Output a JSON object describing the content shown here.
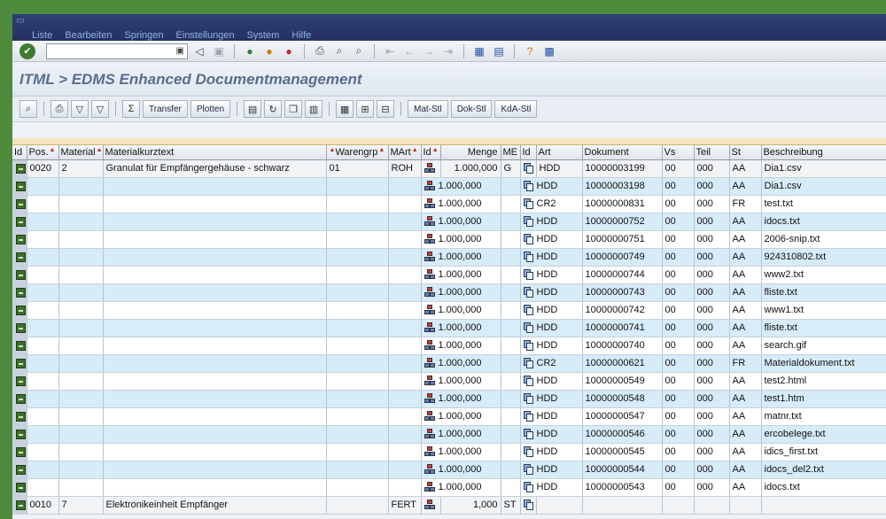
{
  "menu": [
    "Liste",
    "Bearbeiten",
    "Springen",
    "Einstellungen",
    "System",
    "Hilfe"
  ],
  "title": "ITML > EDMS Enhanced Documentmanagement",
  "toolbar_buttons": {
    "transfer": "Transfer",
    "plotten": "Plotten",
    "matstl": "Mat-Stl",
    "dokstl": "Dok-Stl",
    "kdastl": "KdA-Stl"
  },
  "columns": [
    "Id",
    "Pos.",
    "Material",
    "Materialkurztext",
    "Warengrp",
    "MArt",
    "Id",
    "Menge",
    "ME",
    "Id",
    "Art",
    "Dokument",
    "Vs",
    "Teil",
    "St",
    "Beschreibung"
  ],
  "main_rows": [
    {
      "pos": "0020",
      "material": "2",
      "text": "Granulat für Empfängergehäuse - schwarz",
      "warengrp": "01",
      "mart": "ROH",
      "menge": "1.000,000",
      "me": "G",
      "art": "HDD",
      "dokument": "10000003199",
      "vs": "00",
      "teil": "000",
      "st": "AA",
      "beschreibung": "Dia1.csv"
    },
    {
      "pos": "0010",
      "material": "7",
      "text": "Elektronikeinheit Empfänger",
      "warengrp": "",
      "mart": "FERT",
      "menge": "1,000",
      "me": "ST",
      "art": "",
      "dokument": "",
      "vs": "",
      "teil": "",
      "st": "",
      "beschreibung": ""
    }
  ],
  "doc_rows": [
    {
      "menge": "1.000,000",
      "art": "HDD",
      "dokument": "10000003198",
      "vs": "00",
      "teil": "000",
      "st": "AA",
      "beschreibung": "Dia1.csv"
    },
    {
      "menge": "1.000,000",
      "art": "CR2",
      "dokument": "10000000831",
      "vs": "00",
      "teil": "000",
      "st": "FR",
      "beschreibung": "test.txt"
    },
    {
      "menge": "1.000,000",
      "art": "HDD",
      "dokument": "10000000752",
      "vs": "00",
      "teil": "000",
      "st": "AA",
      "beschreibung": "idocs.txt"
    },
    {
      "menge": "1.000,000",
      "art": "HDD",
      "dokument": "10000000751",
      "vs": "00",
      "teil": "000",
      "st": "AA",
      "beschreibung": "2006-snip.txt"
    },
    {
      "menge": "1.000,000",
      "art": "HDD",
      "dokument": "10000000749",
      "vs": "00",
      "teil": "000",
      "st": "AA",
      "beschreibung": "924310802.txt"
    },
    {
      "menge": "1.000,000",
      "art": "HDD",
      "dokument": "10000000744",
      "vs": "00",
      "teil": "000",
      "st": "AA",
      "beschreibung": "www2.txt"
    },
    {
      "menge": "1.000,000",
      "art": "HDD",
      "dokument": "10000000743",
      "vs": "00",
      "teil": "000",
      "st": "AA",
      "beschreibung": "fliste.txt"
    },
    {
      "menge": "1.000,000",
      "art": "HDD",
      "dokument": "10000000742",
      "vs": "00",
      "teil": "000",
      "st": "AA",
      "beschreibung": "www1.txt"
    },
    {
      "menge": "1.000,000",
      "art": "HDD",
      "dokument": "10000000741",
      "vs": "00",
      "teil": "000",
      "st": "AA",
      "beschreibung": "fliste.txt"
    },
    {
      "menge": "1.000,000",
      "art": "HDD",
      "dokument": "10000000740",
      "vs": "00",
      "teil": "000",
      "st": "AA",
      "beschreibung": "search.gif"
    },
    {
      "menge": "1.000,000",
      "art": "CR2",
      "dokument": "10000000621",
      "vs": "00",
      "teil": "000",
      "st": "FR",
      "beschreibung": "Materialdokument.txt"
    },
    {
      "menge": "1.000,000",
      "art": "HDD",
      "dokument": "10000000549",
      "vs": "00",
      "teil": "000",
      "st": "AA",
      "beschreibung": "test2.html"
    },
    {
      "menge": "1.000,000",
      "art": "HDD",
      "dokument": "10000000548",
      "vs": "00",
      "teil": "000",
      "st": "AA",
      "beschreibung": "test1.htm"
    },
    {
      "menge": "1.000,000",
      "art": "HDD",
      "dokument": "10000000547",
      "vs": "00",
      "teil": "000",
      "st": "AA",
      "beschreibung": "matnr.txt"
    },
    {
      "menge": "1.000,000",
      "art": "HDD",
      "dokument": "10000000546",
      "vs": "00",
      "teil": "000",
      "st": "AA",
      "beschreibung": "ercobelege.txt"
    },
    {
      "menge": "1.000,000",
      "art": "HDD",
      "dokument": "10000000545",
      "vs": "00",
      "teil": "000",
      "st": "AA",
      "beschreibung": "idics_first.txt"
    },
    {
      "menge": "1.000,000",
      "art": "HDD",
      "dokument": "10000000544",
      "vs": "00",
      "teil": "000",
      "st": "AA",
      "beschreibung": "idocs_del2.txt"
    },
    {
      "menge": "1.000,000",
      "art": "HDD",
      "dokument": "10000000543",
      "vs": "00",
      "teil": "000",
      "st": "AA",
      "beschreibung": "idocs.txt"
    }
  ]
}
